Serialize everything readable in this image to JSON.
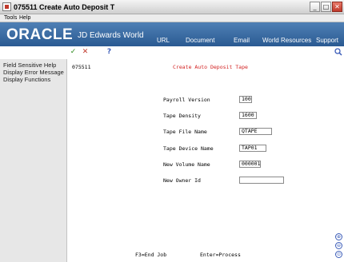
{
  "window": {
    "title": "075511   Create Auto Deposit T",
    "minimize": "_",
    "maximize": "□",
    "close": "✕"
  },
  "menu": {
    "tools": "Tools",
    "help": "Help"
  },
  "banner": {
    "brand": "ORACLE",
    "product": "JD Edwards World",
    "nav": {
      "url": "URL",
      "document": "Document",
      "email": "Email",
      "world_resources": "World Resources",
      "support": "Support"
    }
  },
  "toolbar": {
    "ok_glyph": "✓",
    "cancel_glyph": "✕",
    "help_glyph": "?",
    "search_glyph": "🔍"
  },
  "left_panel": {
    "items": [
      "Field Sensitive Help",
      "Display Error Message",
      "Display Functions"
    ]
  },
  "screen": {
    "program_id": "075511",
    "title": "Create Auto Deposit Tape",
    "fields": [
      {
        "label": "Payroll Version",
        "value": "100"
      },
      {
        "label": "Tape Density",
        "value": "1600"
      },
      {
        "label": "Tape File Name",
        "value": "QTAPE"
      },
      {
        "label": "Tape Device Name",
        "value": "TAP01"
      },
      {
        "label": "New Volume Name",
        "value": "000001"
      },
      {
        "label": "New Owner Id",
        "value": ""
      }
    ],
    "fkeys": {
      "end": "F3=End Job",
      "enter": "Enter=Process"
    }
  },
  "side_buttons": [
    "⊕",
    "⊖",
    "⊙"
  ],
  "colors": {
    "banner_top": "#4f80b5",
    "banner_bottom": "#2a5a92",
    "title_red": "#d21f1f",
    "left_panel_bg": "#e7e7e7"
  }
}
